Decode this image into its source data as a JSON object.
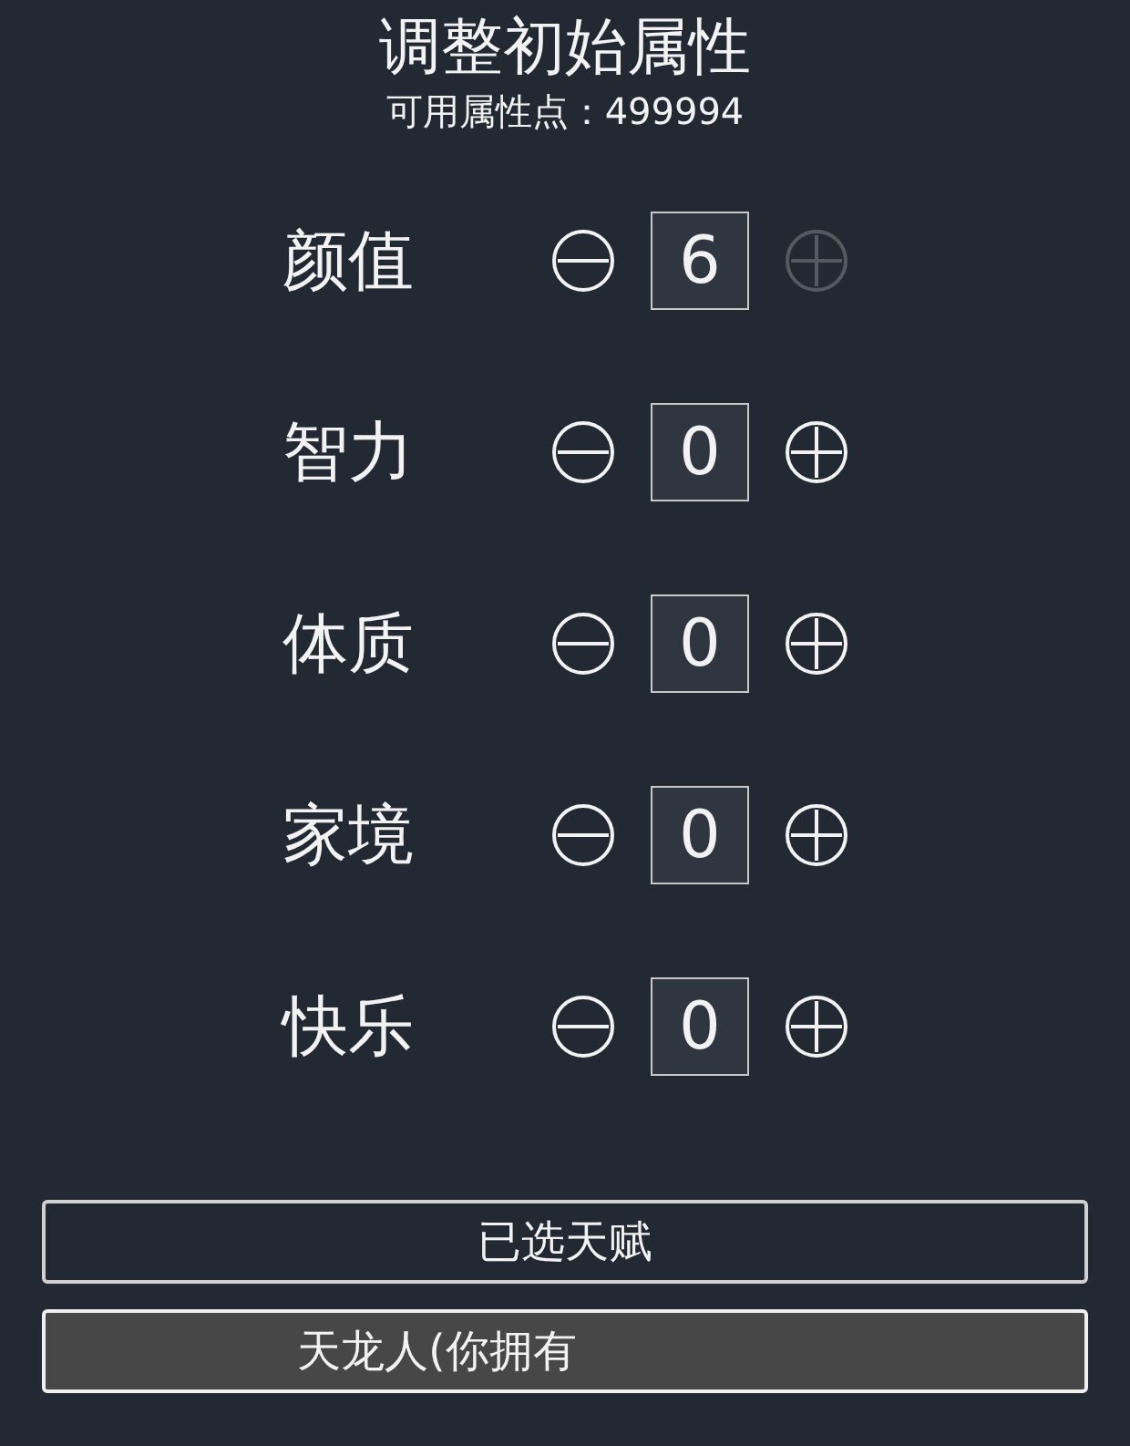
{
  "title": "调整初始属性",
  "points_label": "可用属性点：499994",
  "attributes": [
    {
      "label": "颜值",
      "value": "6",
      "plus_disabled": true
    },
    {
      "label": "智力",
      "value": "0",
      "plus_disabled": false
    },
    {
      "label": "体质",
      "value": "0",
      "plus_disabled": false
    },
    {
      "label": "家境",
      "value": "0",
      "plus_disabled": false
    },
    {
      "label": "快乐",
      "value": "0",
      "plus_disabled": false
    }
  ],
  "buttons": [
    {
      "label": "已选天赋",
      "selected": false
    },
    {
      "label": "天龙人(你拥有",
      "selected": true
    }
  ]
}
